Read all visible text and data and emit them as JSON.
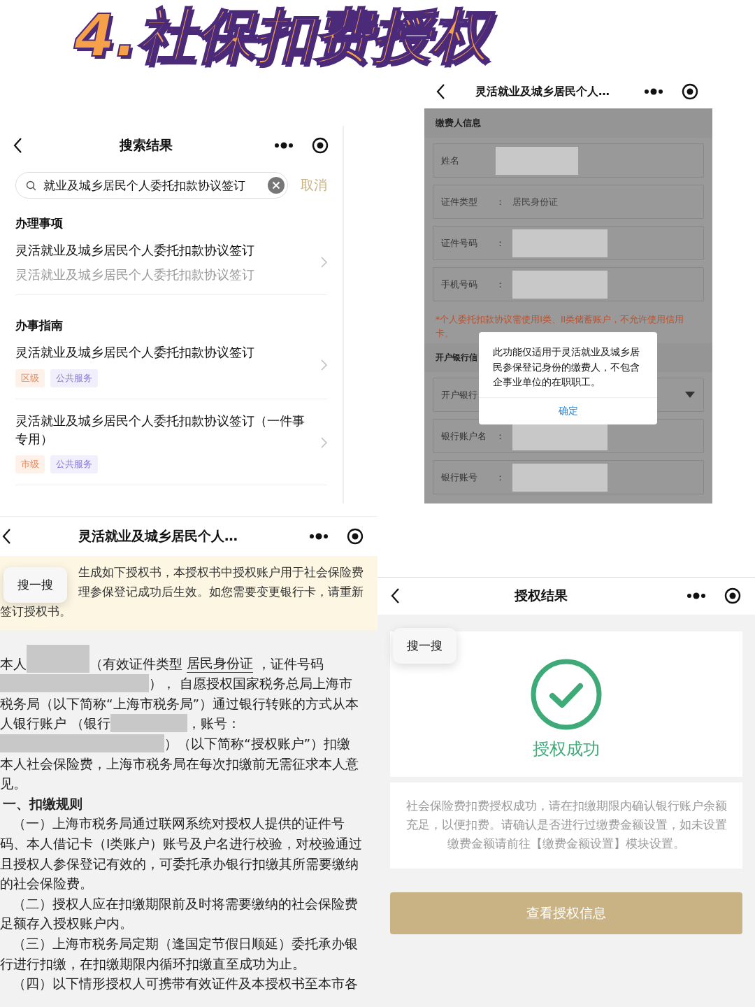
{
  "title": "4.社保扣费授权",
  "search_page": {
    "nav_title": "搜索结果",
    "search_value": "就业及城乡居民个人委托扣款协议签订",
    "cancel": "取消",
    "sections": [
      {
        "heading": "办理事项",
        "items": [
          {
            "title": "灵活就业及城乡居民个人委托扣款协议签订",
            "subtitle": "灵活就业及城乡居民个人委托扣款协议签订"
          }
        ]
      },
      {
        "heading": "办事指南",
        "items": [
          {
            "title": "灵活就业及城乡居民个人委托扣款协议签订",
            "tags": [
              {
                "label": "区级",
                "kind": "level"
              },
              {
                "label": "公共服务",
                "kind": "service"
              }
            ]
          },
          {
            "title": "灵活就业及城乡居民个人委托扣款协议签订（一件事专用）",
            "tags": [
              {
                "label": "市级",
                "kind": "level"
              },
              {
                "label": "公共服务",
                "kind": "service"
              }
            ]
          }
        ]
      }
    ]
  },
  "form_page": {
    "nav_title": "灵活就业及城乡居民个人…",
    "section": "缴费人信息",
    "fields": [
      {
        "label": "姓名",
        "kind": "redacted"
      },
      {
        "label": "证件类型",
        "colon": "：",
        "kind": "text",
        "value": "居民身份证"
      },
      {
        "label": "证件号码",
        "colon": "：",
        "kind": "redacted"
      },
      {
        "label": "手机号码",
        "colon": "：",
        "kind": "redacted"
      }
    ],
    "warning": "*个人委托扣款协议需使用I类、II类储蓄账户，不允许使用信用卡。",
    "bank_section": "开户银行信",
    "bank_fields": [
      {
        "label": "开户银行",
        "kind": "select"
      },
      {
        "label": "银行账户名",
        "colon": "：",
        "kind": "redacted"
      },
      {
        "label": "银行账号",
        "colon": "：",
        "kind": "redacted"
      }
    ],
    "dialog": {
      "message": "此功能仅适用于灵活就业及城乡居民参保登记身份的缴费人，不包含企事业单位的在职职工。",
      "button": "确定"
    }
  },
  "agreement_page": {
    "nav_title": "灵活就业及城乡居民个人…",
    "bubble": "搜一搜",
    "notice_lines": [
      {
        "kind": "offset",
        "text": "生成如下授权书，本授权书中授权账户用于社会保险费"
      },
      {
        "kind": "offset",
        "text": "理参保登记成功后生效。如您需要变更银行卡，请重新"
      },
      {
        "kind": "plain",
        "text": "签订授权书。"
      }
    ],
    "lines": [
      {
        "kind": "plain",
        "segments": [
          {
            "kind": "text",
            "text": "本人"
          },
          {
            "kind": "redaction"
          },
          {
            "kind": "text",
            "text": "（有效证件类型"
          },
          {
            "kind": "underlined",
            "text": "居民身份证"
          },
          {
            "kind": "text",
            "text": "，证件号码"
          }
        ]
      },
      {
        "kind": "plain",
        "segments": [
          {
            "kind": "redaction"
          },
          {
            "kind": "text",
            "text": "），  自愿授权国家税务总局上海市"
          }
        ]
      },
      {
        "kind": "plain",
        "segments": [
          {
            "kind": "text",
            "text": "税务局（以下简称“上海市税务局”）通过银行转账的方式从本"
          }
        ]
      },
      {
        "kind": "plain",
        "segments": [
          {
            "kind": "text",
            "text": "人银行账户 （银行"
          },
          {
            "kind": "redaction"
          },
          {
            "kind": "text",
            "text": "，账号："
          }
        ]
      },
      {
        "kind": "plain",
        "segments": [
          {
            "kind": "redaction"
          },
          {
            "kind": "text",
            "text": "）（以下简称“授权账户”）扣缴"
          }
        ]
      },
      {
        "kind": "plain",
        "segments": [
          {
            "kind": "text",
            "text": "本人社会保险费，上海市税务局在每次扣缴前无需征求本人意"
          }
        ]
      },
      {
        "kind": "plain",
        "segments": [
          {
            "kind": "text",
            "text": "见。"
          }
        ]
      },
      {
        "kind": "heading",
        "segments": [
          {
            "kind": "text",
            "text": "一、扣缴规则"
          }
        ]
      },
      {
        "kind": "indent",
        "segments": [
          {
            "kind": "text",
            "text": "（一）上海市税务局通过联网系统对授权人提供的证件号"
          }
        ]
      },
      {
        "kind": "plain",
        "segments": [
          {
            "kind": "text",
            "text": "码、本人借记卡（I类账户）账号及户名进行校验，对校验通过"
          }
        ]
      },
      {
        "kind": "plain",
        "segments": [
          {
            "kind": "text",
            "text": "且授权人参保登记有效的，可委托承办银行扣缴其所需要缴纳"
          }
        ]
      },
      {
        "kind": "plain",
        "segments": [
          {
            "kind": "text",
            "text": "的社会保险费。"
          }
        ]
      },
      {
        "kind": "indent",
        "segments": [
          {
            "kind": "text",
            "text": "（二）授权人应在扣缴期限前及时将需要缴纳的社会保险费"
          }
        ]
      },
      {
        "kind": "plain",
        "segments": [
          {
            "kind": "text",
            "text": "足额存入授权账户内。"
          }
        ]
      },
      {
        "kind": "indent",
        "segments": [
          {
            "kind": "text",
            "text": "（三）上海市税务局定期（逢国定节假日顺延）委托承办银"
          }
        ]
      },
      {
        "kind": "plain",
        "segments": [
          {
            "kind": "text",
            "text": "行进行扣缴，在扣缴期限内循环扣缴直至成功为止。"
          }
        ]
      },
      {
        "kind": "indent",
        "segments": [
          {
            "kind": "text",
            "text": "（四）以下情形授权人可携带有效证件及本授权书至本市各"
          }
        ]
      }
    ]
  },
  "result_page": {
    "nav_title": "授权结果",
    "bubble": "搜一搜",
    "status": "授权成功",
    "message": "社会保险费扣费授权成功，请在扣缴期限内确认银行账户余额充足，以便扣费。请确认是否进行过缴费金额设置，如未设置缴费金额请前往【缴费金额设置】模块设置。",
    "button": "查看授权信息"
  }
}
